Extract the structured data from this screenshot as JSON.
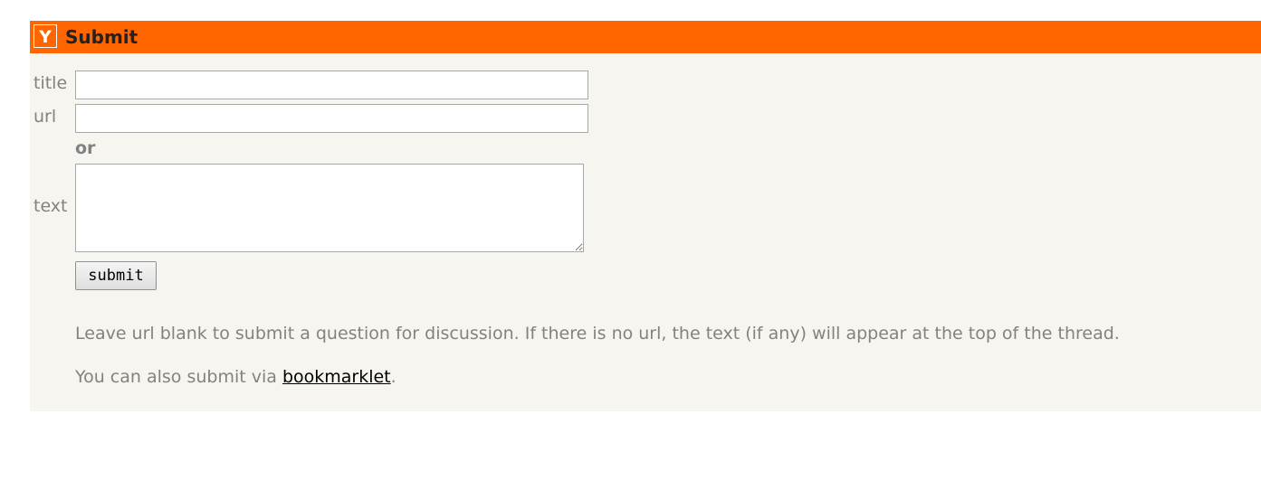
{
  "header": {
    "logo_letter": "Y",
    "title": "Submit",
    "brand_color": "#ff6600"
  },
  "form": {
    "title_label": "title",
    "title_value": "",
    "url_label": "url",
    "url_value": "",
    "or_label": "or",
    "text_label": "text",
    "text_value": "",
    "submit_label": "submit"
  },
  "notes": {
    "blank_url_note": "Leave url blank to submit a question for discussion. If there is no url, the text (if any) will appear at the top of the thread.",
    "bookmarklet_prefix": "You can also submit via ",
    "bookmarklet_link": "bookmarklet",
    "bookmarklet_suffix": "."
  }
}
